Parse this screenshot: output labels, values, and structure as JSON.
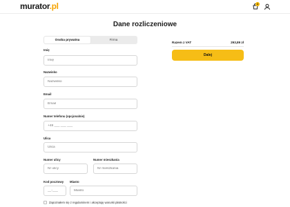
{
  "header": {
    "logo_main": "murator",
    "logo_tld": ".pl",
    "cart_icon": "cart-icon",
    "cart_count": "1",
    "user_icon": "user-icon",
    "accent_color": "#f6bd16"
  },
  "page": {
    "title": "Dane rozliczeniowe"
  },
  "tabs": [
    {
      "label": "Osoba prywatna",
      "active": true
    },
    {
      "label": "Firma",
      "active": false
    }
  ],
  "form": {
    "first_name": {
      "label": "Imię",
      "placeholder": "Imię"
    },
    "last_name": {
      "label": "Nazwisko",
      "placeholder": "Nazwisko"
    },
    "email": {
      "label": "Email",
      "placeholder": "Email"
    },
    "phone": {
      "label": "Numer telefonu (opcjonalnie)",
      "placeholder": "+48 ___ ___ ___"
    },
    "street": {
      "label": "Ulica",
      "placeholder": "Ulica"
    },
    "street_number": {
      "label": "Numer ulicy",
      "placeholder": "Nr ulicy"
    },
    "apartment_number": {
      "label": "Numer mieszkania",
      "placeholder": "Nr mieszkania"
    },
    "postal_code": {
      "label": "Kod pocztowy",
      "placeholder": "__-___"
    },
    "city": {
      "label": "Miasto",
      "placeholder": "Miasto"
    },
    "accept_label": "Zapoznałem się z regulaminem i akceptuję warunki płatności"
  },
  "summary": {
    "total_label": "Razem z VAT",
    "total_value": "293,89 zł",
    "pay_button": "Dalej"
  }
}
